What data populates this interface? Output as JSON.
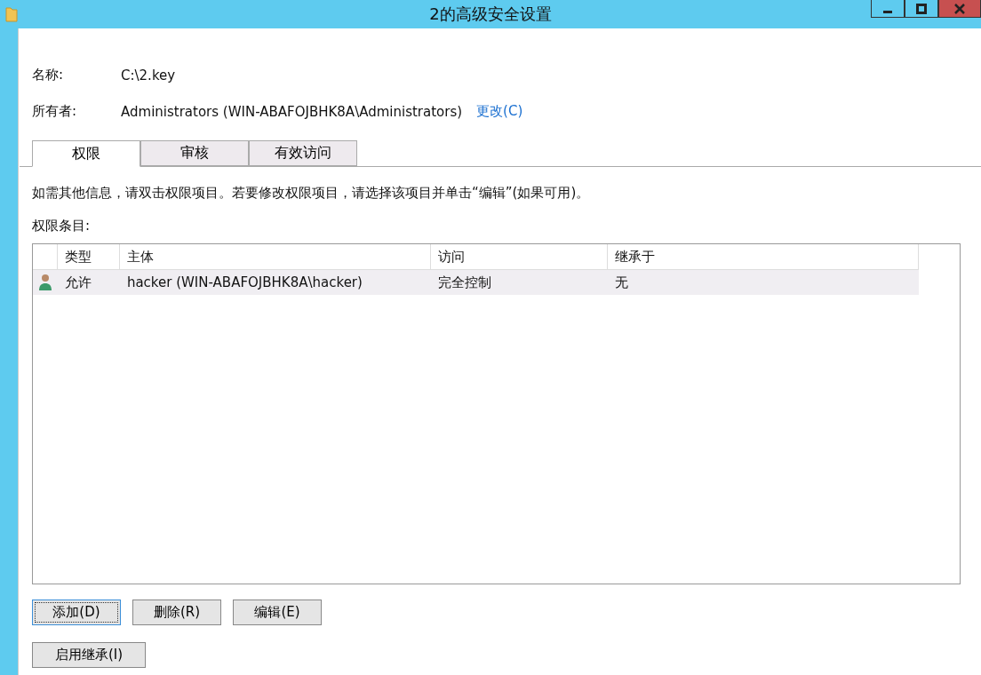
{
  "window": {
    "title": "2的高级安全设置"
  },
  "name_label": "名称:",
  "name_value": "C:\\2.key",
  "owner_label": "所有者:",
  "owner_value": "Administrators (WIN-ABAFOJBHK8A\\Administrators)",
  "owner_change": "更改(C)",
  "tabs": [
    {
      "label": "权限",
      "selected": true
    },
    {
      "label": "审核",
      "selected": false
    },
    {
      "label": "有效访问",
      "selected": false
    }
  ],
  "info": "如需其他信息，请双击权限项目。若要修改权限项目，请选择该项目并单击“编辑”(如果可用)。",
  "entries_label": "权限条目:",
  "table": {
    "columns": [
      "类型",
      "主体",
      "访问",
      "继承于"
    ],
    "rows": [
      {
        "cells": [
          "允许",
          "hacker (WIN-ABAFOJBHK8A\\hacker)",
          "完全控制",
          "无"
        ],
        "selected": true
      }
    ]
  },
  "buttons": [
    {
      "label": "添加(D)",
      "focused": true
    },
    {
      "label": "删除(R)",
      "focused": false
    },
    {
      "label": "编辑(E)",
      "focused": false
    }
  ],
  "inherit_button": "启用继承(I)"
}
